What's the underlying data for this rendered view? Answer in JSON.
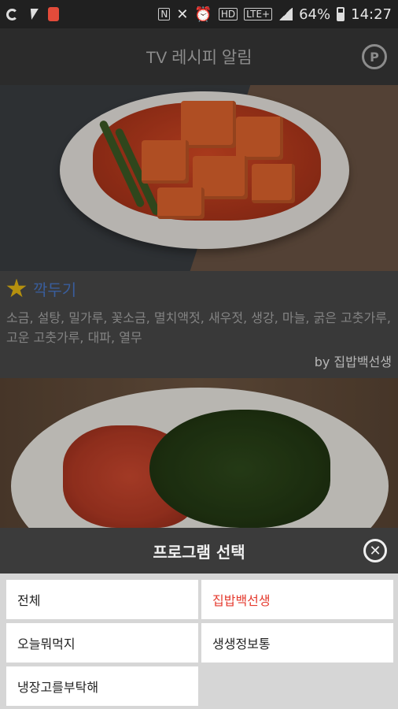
{
  "status_bar": {
    "battery_percent": "64%",
    "time": "14:27",
    "network": "LTE+"
  },
  "app_bar": {
    "title": "TV 레시피 알림",
    "point_button_label": "P"
  },
  "cards": [
    {
      "title": "깍두기",
      "ingredients": "소금, 설탕, 밀가루, 꽃소금, 멸치액젓, 새우젓, 생강, 마늘, 굵은 고춧가루, 고운 고춧가루, 대파, 열무",
      "by": "by 집밥백선생",
      "favorite": true
    },
    {
      "title": "",
      "ingredients": "",
      "by": ""
    }
  ],
  "program_sheet": {
    "title": "프로그램 선택",
    "close_label": "✕",
    "options": [
      {
        "label": "전체",
        "selected": false
      },
      {
        "label": "집밥백선생",
        "selected": true
      },
      {
        "label": "오늘뭐먹지",
        "selected": false
      },
      {
        "label": "생생정보통",
        "selected": false
      },
      {
        "label": "냉장고를부탁해",
        "selected": false
      }
    ]
  },
  "colors": {
    "accent_selected": "#e53a2e",
    "title_link": "#4a78c8",
    "star": "#e8b912"
  }
}
